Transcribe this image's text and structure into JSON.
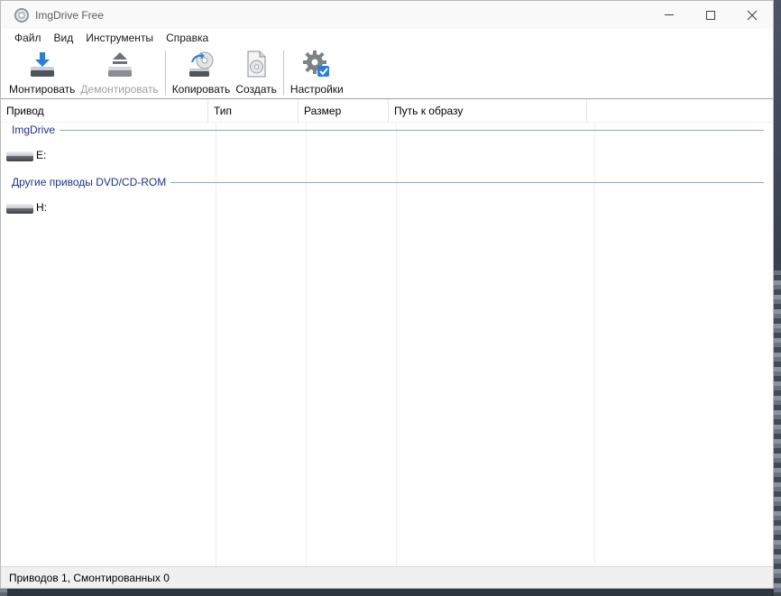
{
  "window": {
    "title": "ImgDrive Free"
  },
  "menu": {
    "items": [
      {
        "label": "Файл"
      },
      {
        "label": "Вид"
      },
      {
        "label": "Инструменты"
      },
      {
        "label": "Справка"
      }
    ]
  },
  "toolbar": {
    "mount_label": "Монтировать",
    "unmount_label": "Демонтировать",
    "copy_label": "Копировать",
    "create_label": "Создать",
    "settings_label": "Настройки"
  },
  "list": {
    "columns": [
      "Привод",
      "Тип",
      "Размер",
      "Путь к образу"
    ],
    "groups": [
      {
        "label": "ImgDrive",
        "drives": [
          {
            "letter": "E:"
          }
        ]
      },
      {
        "label": "Другие приводы DVD/CD-ROM",
        "drives": [
          {
            "letter": "H:"
          }
        ]
      }
    ]
  },
  "status": {
    "text": "Приводов 1, Смонтированных 0"
  },
  "colors": {
    "group_label": "#1e3287",
    "accent_blue": "#2b7fd6"
  }
}
